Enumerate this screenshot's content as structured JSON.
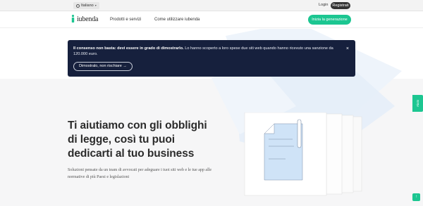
{
  "topbar": {
    "language": "Italiano",
    "login": "Login",
    "register": "Registrati"
  },
  "nav": {
    "logo": "iubenda",
    "links": [
      "Prodotti e servizi",
      "Come utilizzare iubenda"
    ],
    "cta": "Inizia la generazione"
  },
  "notice": {
    "bold": "Il consenso non basta: devi essere in grado di dimostrarlo.",
    "text": " Lo hanno scoperto a loro spese due siti web quando hanno ricevuto una sanzione da 120.000 euro.",
    "button": "Dimostralo, non rischiare →",
    "close": "×"
  },
  "hero": {
    "headline": "Ti aiutiamo con gli obblighi di legge, così tu puoi dedicarti al tuo business",
    "subtext": "Soluzioni pensate da un team di avvocati per adeguare i tuoi siti web e le tue app alle normative di più Paesi e legislazioni"
  },
  "side_tab": "Aiuto",
  "scroll_top": "↑",
  "colors": {
    "accent": "#1cc691",
    "banner": "#16203d",
    "illustration": "#cfe3f7"
  },
  "icons": [
    "globe-icon",
    "chevron-down-icon",
    "close-icon",
    "arrow-up-icon"
  ]
}
